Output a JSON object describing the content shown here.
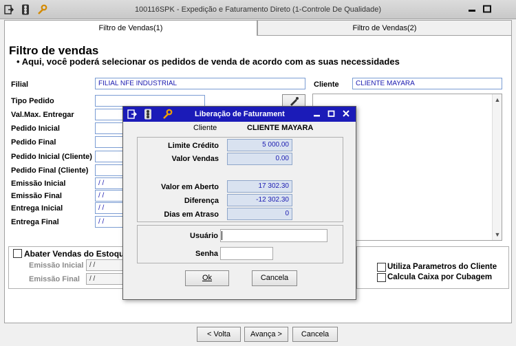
{
  "window": {
    "title": "100116SPK - Expedição e Faturamento Direto (1-Controle De Qualidade)"
  },
  "tabs": [
    {
      "label": "Filtro de Vendas(1)"
    },
    {
      "label": "Filtro de Vendas(2)"
    }
  ],
  "header": {
    "title": "Filtro de vendas",
    "subtitle": "Aqui, você poderá selecionar os pedidos de venda de acordo com as suas necessidades"
  },
  "filial": {
    "label": "Filial",
    "value": "FILIAL NFE INDUSTRIAL"
  },
  "cliente": {
    "label": "Cliente",
    "value": "CLIENTE MAYARA"
  },
  "form": {
    "tipo_pedido": "Tipo Pedido",
    "val_max": "Val.Max. Entregar",
    "pedido_inicial": "Pedido Inicial",
    "pedido_final": "Pedido Final",
    "pedido_inicial_cliente": "Pedido Inicial (Cliente)",
    "pedido_final_cliente": "Pedido Final (Cliente)",
    "emissao_inicial": "Emissão Inicial",
    "emissao_final": "Emissão Final",
    "entrega_inicial": "Entrega Inicial",
    "entrega_final": "Entrega Final",
    "date_placeholder": " /  /"
  },
  "estoque": {
    "checkbox_label": "Abater Vendas do Estoque",
    "emissao_inicial": "Emissão Inicial",
    "emissao_final": "Emissão Final",
    "date_placeholder": " /  /"
  },
  "options": {
    "utiliza_parametros": "Utiliza Parametros do Cliente",
    "calcula_caixa": "Calcula Caixa por Cubagem"
  },
  "footer": {
    "voltar": "< Volta",
    "avancar": "Avança >",
    "cancelar": "Cancela"
  },
  "dialog": {
    "title": "Liberação de Faturament",
    "cliente_label": "Cliente",
    "cliente_value": "CLIENTE MAYARA",
    "limite_credito_label": "Limite Crédito",
    "limite_credito_value": "5 000.00",
    "valor_vendas_label": "Valor Vendas",
    "valor_vendas_value": "0.00",
    "valor_aberto_label": "Valor em Aberto",
    "valor_aberto_value": "17 302.30",
    "diferenca_label": "Diferença",
    "diferenca_value": "-12 302.30",
    "dias_atraso_label": "Dias em Atraso",
    "dias_atraso_value": "0",
    "usuario_label": "Usuário",
    "usuario_value": "",
    "senha_label": "Senha",
    "senha_value": "",
    "ok_label": "Ok",
    "cancela_label": "Cancela"
  },
  "colors": {
    "dialog_title_bg": "#1b1bb8",
    "field_text": "#1a1ab0",
    "field_border": "#7a9cd3"
  }
}
